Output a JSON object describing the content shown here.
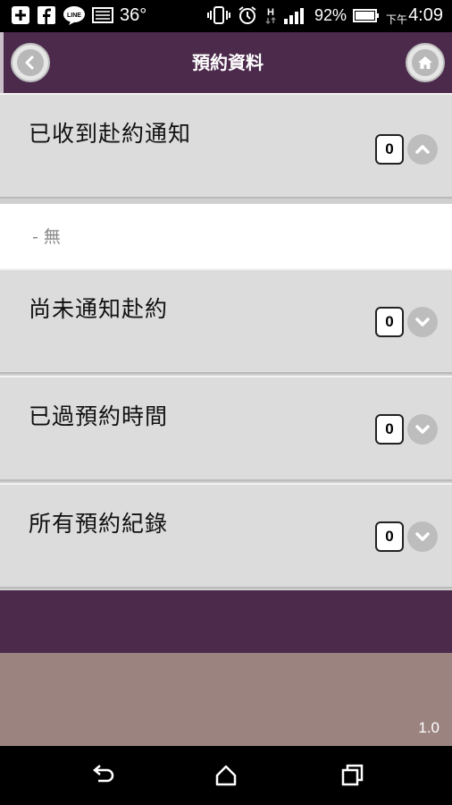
{
  "status_bar": {
    "temperature": "36°",
    "battery_percent": "92%",
    "time_prefix": "下午",
    "time": "4:09",
    "left_icons": [
      "add-icon",
      "facebook-icon",
      "line-icon",
      "image-icon"
    ],
    "right_icons": [
      "vibrate-icon",
      "alarm-icon",
      "data-h-icon",
      "signal-icon",
      "battery-icon"
    ]
  },
  "header": {
    "title": "預約資料",
    "back_icon": "back-arrow-icon",
    "home_icon": "home-icon"
  },
  "sections": [
    {
      "title": "已收到赴約通知",
      "count": "0",
      "expanded": true,
      "toggle_icon": "chevron-up-icon"
    },
    {
      "title": "尚未通知赴約",
      "count": "0",
      "expanded": false,
      "toggle_icon": "chevron-down-icon"
    },
    {
      "title": "已過預約時間",
      "count": "0",
      "expanded": false,
      "toggle_icon": "chevron-down-icon"
    },
    {
      "title": "所有預約紀錄",
      "count": "0",
      "expanded": false,
      "toggle_icon": "chevron-down-icon"
    }
  ],
  "expanded_detail": {
    "text": "- 無"
  },
  "footer": {
    "version": "1.0"
  },
  "colors": {
    "header": "#4b2a4b",
    "footer_band": "#9b8380",
    "section_bg": "#dcdcdc"
  },
  "nav_bar": {
    "icons": [
      "nav-back-icon",
      "nav-home-icon",
      "nav-recents-icon"
    ]
  }
}
